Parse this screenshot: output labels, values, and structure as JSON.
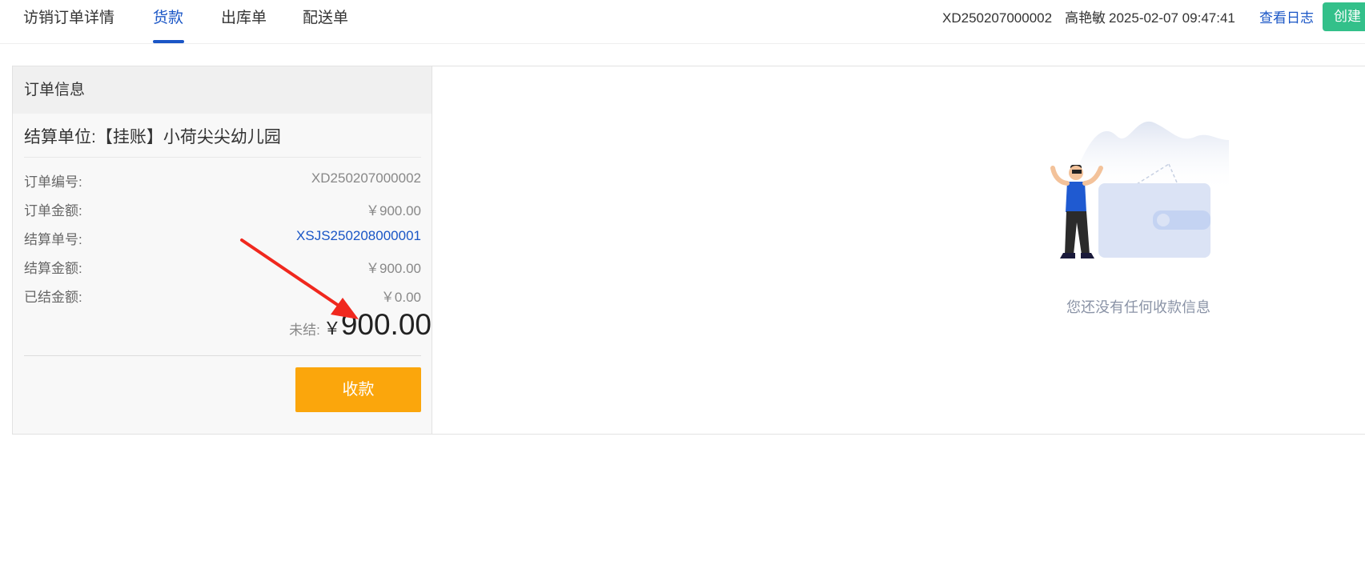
{
  "tabs": [
    {
      "label": "访销订单详情",
      "active": false
    },
    {
      "label": "货款",
      "active": true
    },
    {
      "label": "出库单",
      "active": false
    },
    {
      "label": "配送单",
      "active": false
    }
  ],
  "header": {
    "order_no": "XD250207000002",
    "user": "高艳敏",
    "datetime": "2025-02-07 09:47:41",
    "log_link": "查看日志",
    "create_button": "创建"
  },
  "order_info": {
    "title": "订单信息",
    "settle_unit_label": "结算单位:",
    "settle_unit_value": "【挂账】小荷尖尖幼儿园",
    "rows": [
      {
        "label": "订单编号:",
        "value": "XD250207000002",
        "link": false
      },
      {
        "label": "订单金额:",
        "value": "￥900.00",
        "link": false
      },
      {
        "label": "结算单号:",
        "value": "XSJS250208000001",
        "link": true
      },
      {
        "label": "结算金额:",
        "value": "￥900.00",
        "link": false
      },
      {
        "label": "已结金额:",
        "value": "￥0.00",
        "link": false
      }
    ],
    "unsettled_label": "未结:",
    "unsettled_currency": "￥",
    "unsettled_amount": "900.00",
    "collect_button": "收款"
  },
  "empty_state": {
    "message": "您还没有任何收款信息"
  },
  "colors": {
    "accent": "#1a56c6",
    "collect_button": "#fba60c",
    "create_button": "#33c08a",
    "annotation_arrow": "#f0281e"
  }
}
